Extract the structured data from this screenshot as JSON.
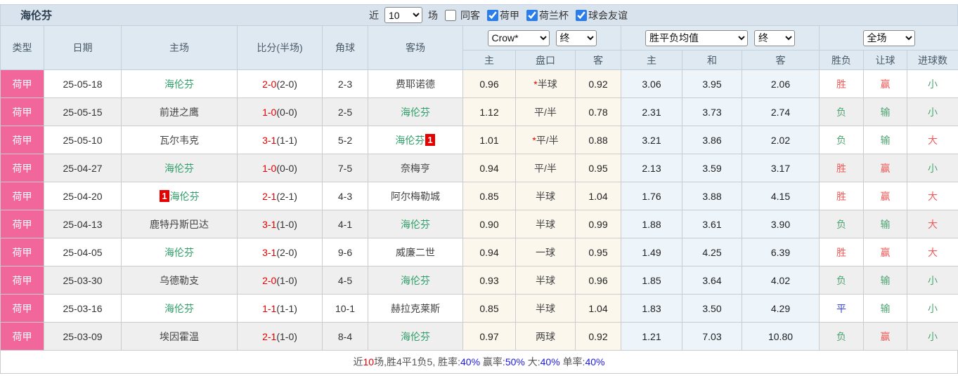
{
  "topbar": {
    "team_title": "海伦芬",
    "recent_label": "近",
    "recent_count": "10",
    "unit_label": "场",
    "same_away": {
      "label": "同客",
      "checked": false
    },
    "league_filters": [
      {
        "label": "荷甲",
        "checked": true
      },
      {
        "label": "荷兰杯",
        "checked": true
      },
      {
        "label": "球会友谊",
        "checked": true
      }
    ]
  },
  "table": {
    "columns": [
      "类型",
      "日期",
      "主场",
      "比分(半场)",
      "角球",
      "客场"
    ],
    "selects": {
      "company": "Crow*",
      "company_time": "终",
      "avg": "胜平负均值",
      "avg_time": "终",
      "scope": "全场"
    },
    "sub": [
      "主",
      "盘口",
      "客",
      "主",
      "和",
      "客",
      "胜负",
      "让球",
      "进球数"
    ],
    "rows": [
      {
        "type": "荷甲",
        "date": "25-05-18",
        "home": {
          "name": "海伦芬",
          "hl": true
        },
        "score": "2-0",
        "half": "(2-0)",
        "corners": "2-3",
        "away": {
          "name": "费耶诺德",
          "hl": false
        },
        "odds_home": "0.96",
        "handicap_star": true,
        "handicap": "半球",
        "odds_away": "0.92",
        "avg_home": "3.06",
        "avg_draw": "3.95",
        "avg_away": "2.06",
        "result": {
          "text": "胜",
          "color": "red"
        },
        "handicap_result": {
          "text": "赢",
          "color": "red"
        },
        "goals": {
          "text": "小",
          "color": "green"
        }
      },
      {
        "type": "荷甲",
        "date": "25-05-15",
        "home": {
          "name": "前进之鹰",
          "hl": false
        },
        "score": "1-0",
        "half": "(0-0)",
        "corners": "2-5",
        "away": {
          "name": "海伦芬",
          "hl": true
        },
        "odds_home": "1.12",
        "handicap_star": false,
        "handicap": "平/半",
        "odds_away": "0.78",
        "avg_home": "2.31",
        "avg_draw": "3.73",
        "avg_away": "2.74",
        "result": {
          "text": "负",
          "color": "green"
        },
        "handicap_result": {
          "text": "输",
          "color": "green"
        },
        "goals": {
          "text": "小",
          "color": "green"
        }
      },
      {
        "type": "荷甲",
        "date": "25-05-10",
        "home": {
          "name": "瓦尔韦克",
          "hl": false
        },
        "score": "3-1",
        "half": "(1-1)",
        "corners": "5-2",
        "away": {
          "name": "海伦芬",
          "hl": true,
          "badge": "1",
          "badge_pos": "after"
        },
        "odds_home": "1.01",
        "handicap_star": true,
        "handicap": "平/半",
        "odds_away": "0.88",
        "avg_home": "3.21",
        "avg_draw": "3.86",
        "avg_away": "2.02",
        "result": {
          "text": "负",
          "color": "green"
        },
        "handicap_result": {
          "text": "输",
          "color": "green"
        },
        "goals": {
          "text": "大",
          "color": "red"
        }
      },
      {
        "type": "荷甲",
        "date": "25-04-27",
        "home": {
          "name": "海伦芬",
          "hl": true
        },
        "score": "1-0",
        "half": "(0-0)",
        "corners": "7-5",
        "away": {
          "name": "奈梅亨",
          "hl": false
        },
        "odds_home": "0.94",
        "handicap_star": false,
        "handicap": "平/半",
        "odds_away": "0.95",
        "avg_home": "2.13",
        "avg_draw": "3.59",
        "avg_away": "3.17",
        "result": {
          "text": "胜",
          "color": "red"
        },
        "handicap_result": {
          "text": "赢",
          "color": "red"
        },
        "goals": {
          "text": "小",
          "color": "green"
        }
      },
      {
        "type": "荷甲",
        "date": "25-04-20",
        "home": {
          "name": "海伦芬",
          "hl": true,
          "badge": "1",
          "badge_pos": "before"
        },
        "score": "2-1",
        "half": "(2-1)",
        "corners": "4-3",
        "away": {
          "name": "阿尔梅勒城",
          "hl": false
        },
        "odds_home": "0.85",
        "handicap_star": false,
        "handicap": "半球",
        "odds_away": "1.04",
        "avg_home": "1.76",
        "avg_draw": "3.88",
        "avg_away": "4.15",
        "result": {
          "text": "胜",
          "color": "red"
        },
        "handicap_result": {
          "text": "赢",
          "color": "red"
        },
        "goals": {
          "text": "大",
          "color": "red"
        }
      },
      {
        "type": "荷甲",
        "date": "25-04-13",
        "home": {
          "name": "鹿特丹斯巴达",
          "hl": false
        },
        "score": "3-1",
        "half": "(1-0)",
        "corners": "4-1",
        "away": {
          "name": "海伦芬",
          "hl": true
        },
        "odds_home": "0.90",
        "handicap_star": false,
        "handicap": "半球",
        "odds_away": "0.99",
        "avg_home": "1.88",
        "avg_draw": "3.61",
        "avg_away": "3.90",
        "result": {
          "text": "负",
          "color": "green"
        },
        "handicap_result": {
          "text": "输",
          "color": "green"
        },
        "goals": {
          "text": "大",
          "color": "red"
        }
      },
      {
        "type": "荷甲",
        "date": "25-04-05",
        "home": {
          "name": "海伦芬",
          "hl": true
        },
        "score": "3-1",
        "half": "(2-0)",
        "corners": "9-6",
        "away": {
          "name": "威廉二世",
          "hl": false
        },
        "odds_home": "0.94",
        "handicap_star": false,
        "handicap": "一球",
        "odds_away": "0.95",
        "avg_home": "1.49",
        "avg_draw": "4.25",
        "avg_away": "6.39",
        "result": {
          "text": "胜",
          "color": "red"
        },
        "handicap_result": {
          "text": "赢",
          "color": "red"
        },
        "goals": {
          "text": "大",
          "color": "red"
        }
      },
      {
        "type": "荷甲",
        "date": "25-03-30",
        "home": {
          "name": "乌德勒支",
          "hl": false
        },
        "score": "2-0",
        "half": "(1-0)",
        "corners": "4-5",
        "away": {
          "name": "海伦芬",
          "hl": true
        },
        "odds_home": "0.93",
        "handicap_star": false,
        "handicap": "半球",
        "odds_away": "0.96",
        "avg_home": "1.85",
        "avg_draw": "3.64",
        "avg_away": "4.02",
        "result": {
          "text": "负",
          "color": "green"
        },
        "handicap_result": {
          "text": "输",
          "color": "green"
        },
        "goals": {
          "text": "小",
          "color": "green"
        }
      },
      {
        "type": "荷甲",
        "date": "25-03-16",
        "home": {
          "name": "海伦芬",
          "hl": true
        },
        "score": "1-1",
        "half": "(1-1)",
        "corners": "10-1",
        "away": {
          "name": "赫拉克莱斯",
          "hl": false
        },
        "odds_home": "0.85",
        "handicap_star": false,
        "handicap": "半球",
        "odds_away": "1.04",
        "avg_home": "1.83",
        "avg_draw": "3.50",
        "avg_away": "4.29",
        "result": {
          "text": "平",
          "color": "blue"
        },
        "handicap_result": {
          "text": "输",
          "color": "green"
        },
        "goals": {
          "text": "小",
          "color": "green"
        }
      },
      {
        "type": "荷甲",
        "date": "25-03-09",
        "home": {
          "name": "埃因霍温",
          "hl": false
        },
        "score": "2-1",
        "half": "(1-0)",
        "corners": "8-4",
        "away": {
          "name": "海伦芬",
          "hl": true
        },
        "odds_home": "0.97",
        "handicap_star": false,
        "handicap": "两球",
        "odds_away": "0.92",
        "avg_home": "1.21",
        "avg_draw": "7.03",
        "avg_away": "10.80",
        "result": {
          "text": "负",
          "color": "green"
        },
        "handicap_result": {
          "text": "赢",
          "color": "red"
        },
        "goals": {
          "text": "小",
          "color": "green"
        }
      }
    ]
  },
  "summary": {
    "segments": [
      {
        "text": "近",
        "color": "dark"
      },
      {
        "text": "10",
        "color": "red"
      },
      {
        "text": "场,胜4平1负5, 胜率:",
        "color": "dark"
      },
      {
        "text": "40%",
        "color": "blue"
      },
      {
        "text": " 赢率:",
        "color": "dark"
      },
      {
        "text": "50%",
        "color": "blue"
      },
      {
        "text": " 大:",
        "color": "dark"
      },
      {
        "text": "40%",
        "color": "blue"
      },
      {
        "text": " 单率:",
        "color": "dark"
      },
      {
        "text": "40%",
        "color": "blue"
      }
    ]
  },
  "colors": {
    "league_pink": "#f1679c",
    "team_green": "#2f9e68",
    "score_red": "#e60000",
    "win_red": "#ef5a5a",
    "lose_green": "#4fa472",
    "draw_blue": "#3143d6",
    "percent_blue": "#1a1ae6",
    "header_blue_gray": "#dfe9f2",
    "handicap_cream": "#fbf7ed",
    "avg_lightblue": "#edf4fa"
  }
}
